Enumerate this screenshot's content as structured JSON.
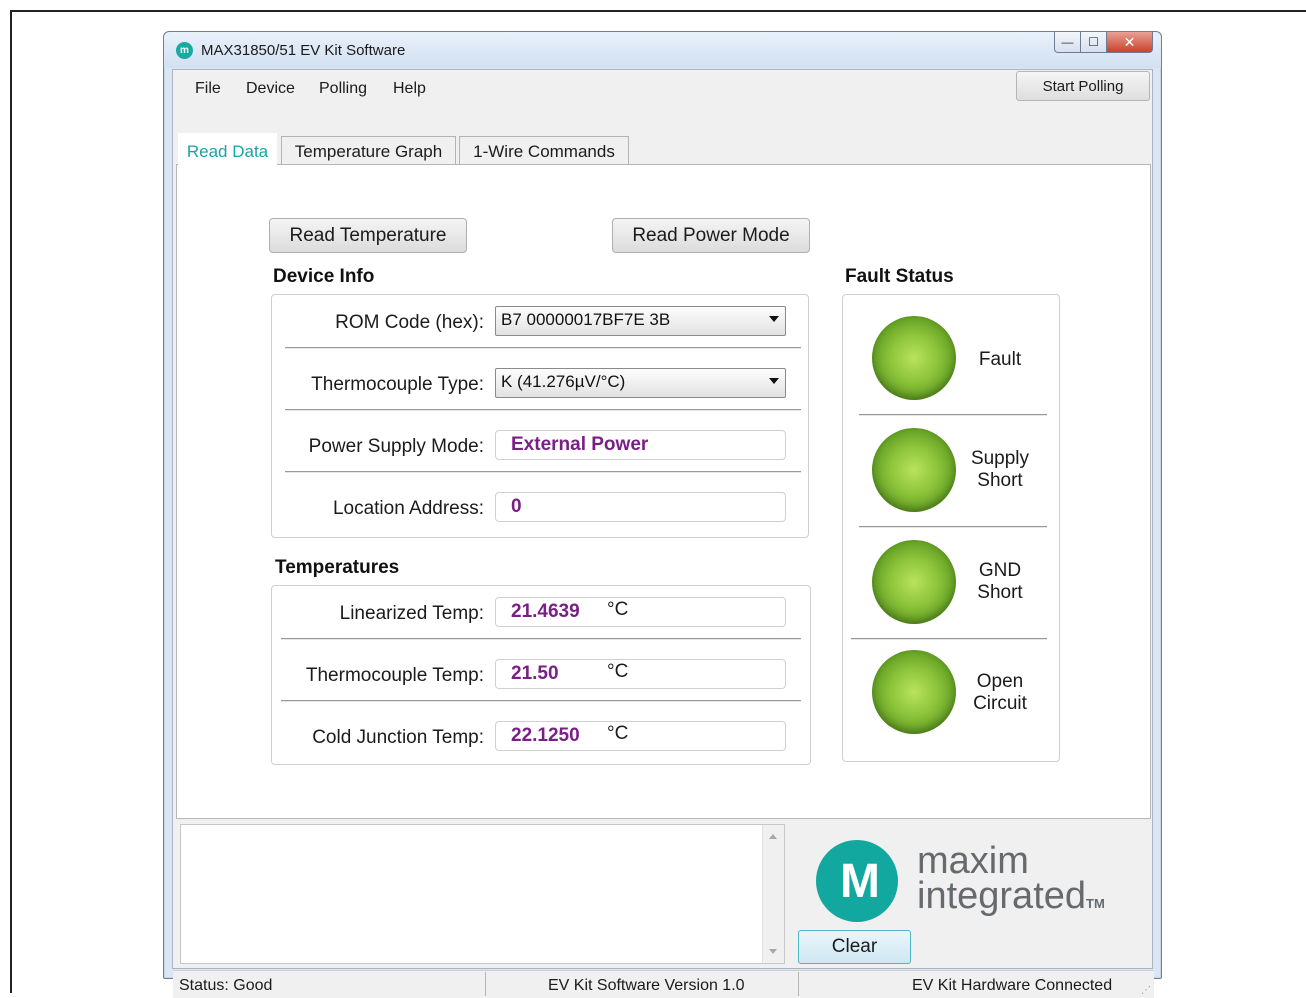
{
  "window": {
    "title": "MAX31850/51 EV Kit Software",
    "icon_glyph": "m",
    "controls": {
      "minimize": "—",
      "maximize": "☐",
      "close": "✕"
    }
  },
  "menu": {
    "items": [
      "File",
      "Device",
      "Polling",
      "Help"
    ],
    "start_polling": "Start Polling"
  },
  "tabs": [
    "Read Data",
    "Temperature Graph",
    "1-Wire Commands"
  ],
  "buttons": {
    "read_temperature": "Read Temperature",
    "read_power_mode": "Read Power Mode"
  },
  "device_info": {
    "title": "Device Info",
    "rom_code_label": "ROM Code (hex):",
    "rom_code_value": "B7 00000017BF7E 3B",
    "thermocouple_type_label": "Thermocouple Type:",
    "thermocouple_type_value": "K (41.276µV/°C)",
    "power_supply_label": "Power Supply Mode:",
    "power_supply_value": "External Power",
    "location_label": "Location Address:",
    "location_value": "0"
  },
  "temperatures": {
    "title": "Temperatures",
    "linearized_label": "Linearized Temp:",
    "linearized_value": "21.4639",
    "thermocouple_label": "Thermocouple Temp:",
    "thermocouple_value": "21.50",
    "cold_junction_label": "Cold Junction Temp:",
    "cold_junction_value": "22.1250",
    "unit": "°C"
  },
  "fault_status": {
    "title": "Fault Status",
    "fault": "Fault",
    "supply_short_1": "Supply",
    "supply_short_2": "Short",
    "gnd_short_1": "GND",
    "gnd_short_2": "Short",
    "open_circuit_1": "Open",
    "open_circuit_2": "Circuit",
    "led_color": "#8cc43b"
  },
  "logo": {
    "mark": "M",
    "line1": "maxim",
    "line2": "integrated",
    "tm": "TM",
    "brand_color": "#12a89f"
  },
  "clear_button": "Clear",
  "status": {
    "left": "Status: Good",
    "center": "EV Kit Software Version 1.0",
    "right": "EV Kit Hardware Connected"
  }
}
